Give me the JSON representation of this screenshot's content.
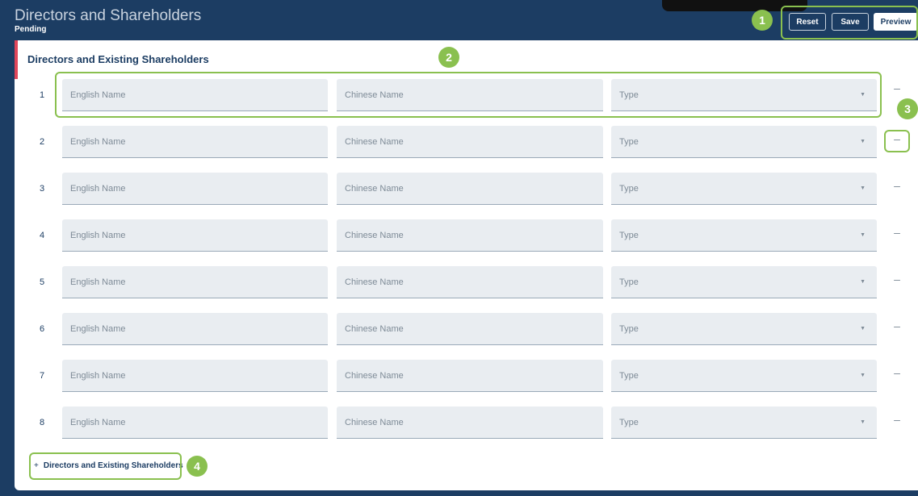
{
  "header": {
    "title": "Directors and Shareholders",
    "status": "Pending",
    "buttons": {
      "reset": "Reset",
      "save": "Save",
      "preview": "Preview"
    }
  },
  "section": {
    "title": "Directors and Existing Shareholders",
    "placeholders": {
      "english_name": "English Name",
      "chinese_name": "Chinese Name",
      "type": "Type"
    },
    "rows": [
      "1",
      "2",
      "3",
      "4",
      "5",
      "6",
      "7",
      "8"
    ],
    "remove_label": "–",
    "add_label": "Directors and Existing Shareholders",
    "add_prefix": "+"
  },
  "annotations": [
    "1",
    "2",
    "3",
    "4"
  ],
  "colors": {
    "brand": "#1c3d63",
    "accent": "#e0465a",
    "highlight": "#8ac04f",
    "field_bg": "#e9edf1"
  }
}
